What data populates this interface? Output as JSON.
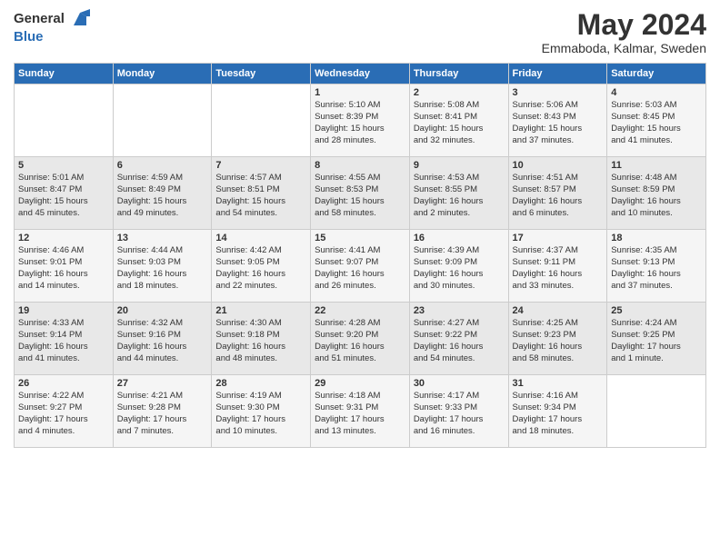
{
  "header": {
    "logo_line1": "General",
    "logo_line2": "Blue",
    "month": "May 2024",
    "location": "Emmaboda, Kalmar, Sweden"
  },
  "days_of_week": [
    "Sunday",
    "Monday",
    "Tuesday",
    "Wednesday",
    "Thursday",
    "Friday",
    "Saturday"
  ],
  "weeks": [
    [
      {
        "day": "",
        "content": ""
      },
      {
        "day": "",
        "content": ""
      },
      {
        "day": "",
        "content": ""
      },
      {
        "day": "1",
        "content": "Sunrise: 5:10 AM\nSunset: 8:39 PM\nDaylight: 15 hours\nand 28 minutes."
      },
      {
        "day": "2",
        "content": "Sunrise: 5:08 AM\nSunset: 8:41 PM\nDaylight: 15 hours\nand 32 minutes."
      },
      {
        "day": "3",
        "content": "Sunrise: 5:06 AM\nSunset: 8:43 PM\nDaylight: 15 hours\nand 37 minutes."
      },
      {
        "day": "4",
        "content": "Sunrise: 5:03 AM\nSunset: 8:45 PM\nDaylight: 15 hours\nand 41 minutes."
      }
    ],
    [
      {
        "day": "5",
        "content": "Sunrise: 5:01 AM\nSunset: 8:47 PM\nDaylight: 15 hours\nand 45 minutes."
      },
      {
        "day": "6",
        "content": "Sunrise: 4:59 AM\nSunset: 8:49 PM\nDaylight: 15 hours\nand 49 minutes."
      },
      {
        "day": "7",
        "content": "Sunrise: 4:57 AM\nSunset: 8:51 PM\nDaylight: 15 hours\nand 54 minutes."
      },
      {
        "day": "8",
        "content": "Sunrise: 4:55 AM\nSunset: 8:53 PM\nDaylight: 15 hours\nand 58 minutes."
      },
      {
        "day": "9",
        "content": "Sunrise: 4:53 AM\nSunset: 8:55 PM\nDaylight: 16 hours\nand 2 minutes."
      },
      {
        "day": "10",
        "content": "Sunrise: 4:51 AM\nSunset: 8:57 PM\nDaylight: 16 hours\nand 6 minutes."
      },
      {
        "day": "11",
        "content": "Sunrise: 4:48 AM\nSunset: 8:59 PM\nDaylight: 16 hours\nand 10 minutes."
      }
    ],
    [
      {
        "day": "12",
        "content": "Sunrise: 4:46 AM\nSunset: 9:01 PM\nDaylight: 16 hours\nand 14 minutes."
      },
      {
        "day": "13",
        "content": "Sunrise: 4:44 AM\nSunset: 9:03 PM\nDaylight: 16 hours\nand 18 minutes."
      },
      {
        "day": "14",
        "content": "Sunrise: 4:42 AM\nSunset: 9:05 PM\nDaylight: 16 hours\nand 22 minutes."
      },
      {
        "day": "15",
        "content": "Sunrise: 4:41 AM\nSunset: 9:07 PM\nDaylight: 16 hours\nand 26 minutes."
      },
      {
        "day": "16",
        "content": "Sunrise: 4:39 AM\nSunset: 9:09 PM\nDaylight: 16 hours\nand 30 minutes."
      },
      {
        "day": "17",
        "content": "Sunrise: 4:37 AM\nSunset: 9:11 PM\nDaylight: 16 hours\nand 33 minutes."
      },
      {
        "day": "18",
        "content": "Sunrise: 4:35 AM\nSunset: 9:13 PM\nDaylight: 16 hours\nand 37 minutes."
      }
    ],
    [
      {
        "day": "19",
        "content": "Sunrise: 4:33 AM\nSunset: 9:14 PM\nDaylight: 16 hours\nand 41 minutes."
      },
      {
        "day": "20",
        "content": "Sunrise: 4:32 AM\nSunset: 9:16 PM\nDaylight: 16 hours\nand 44 minutes."
      },
      {
        "day": "21",
        "content": "Sunrise: 4:30 AM\nSunset: 9:18 PM\nDaylight: 16 hours\nand 48 minutes."
      },
      {
        "day": "22",
        "content": "Sunrise: 4:28 AM\nSunset: 9:20 PM\nDaylight: 16 hours\nand 51 minutes."
      },
      {
        "day": "23",
        "content": "Sunrise: 4:27 AM\nSunset: 9:22 PM\nDaylight: 16 hours\nand 54 minutes."
      },
      {
        "day": "24",
        "content": "Sunrise: 4:25 AM\nSunset: 9:23 PM\nDaylight: 16 hours\nand 58 minutes."
      },
      {
        "day": "25",
        "content": "Sunrise: 4:24 AM\nSunset: 9:25 PM\nDaylight: 17 hours\nand 1 minute."
      }
    ],
    [
      {
        "day": "26",
        "content": "Sunrise: 4:22 AM\nSunset: 9:27 PM\nDaylight: 17 hours\nand 4 minutes."
      },
      {
        "day": "27",
        "content": "Sunrise: 4:21 AM\nSunset: 9:28 PM\nDaylight: 17 hours\nand 7 minutes."
      },
      {
        "day": "28",
        "content": "Sunrise: 4:19 AM\nSunset: 9:30 PM\nDaylight: 17 hours\nand 10 minutes."
      },
      {
        "day": "29",
        "content": "Sunrise: 4:18 AM\nSunset: 9:31 PM\nDaylight: 17 hours\nand 13 minutes."
      },
      {
        "day": "30",
        "content": "Sunrise: 4:17 AM\nSunset: 9:33 PM\nDaylight: 17 hours\nand 16 minutes."
      },
      {
        "day": "31",
        "content": "Sunrise: 4:16 AM\nSunset: 9:34 PM\nDaylight: 17 hours\nand 18 minutes."
      },
      {
        "day": "",
        "content": ""
      }
    ]
  ]
}
